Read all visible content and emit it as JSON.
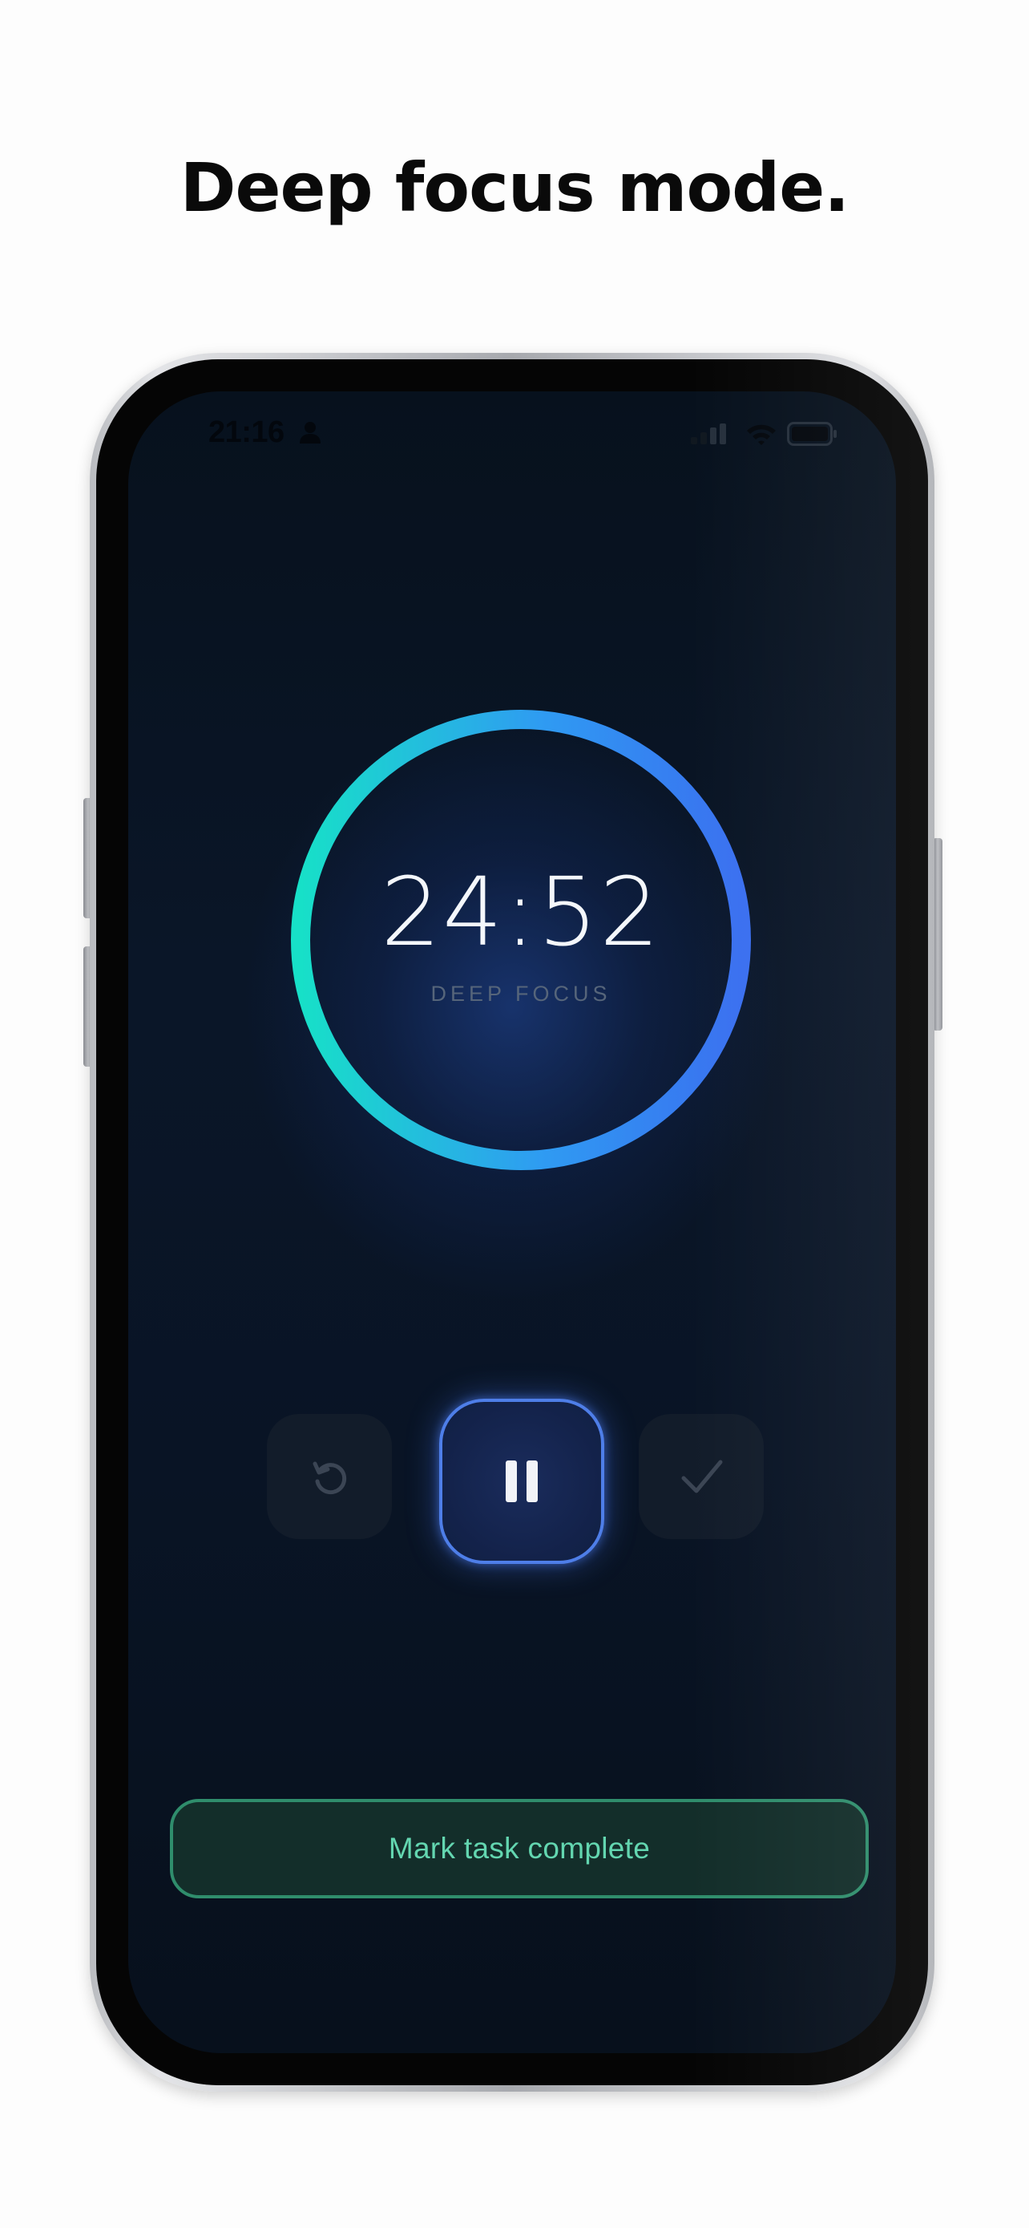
{
  "headline": "Deep focus mode.",
  "status_bar": {
    "time": "21:16",
    "icons": [
      "person-icon",
      "signal-icon",
      "wifi-icon",
      "battery-icon"
    ]
  },
  "timer": {
    "value": "24:52",
    "label": "DEEP FOCUS",
    "ring_gradient": [
      "#17e0c8",
      "#2f9bf2",
      "#3a6ff0"
    ]
  },
  "controls": {
    "reset_icon": "reset-icon",
    "pause_icon": "pause-icon",
    "done_icon": "checkmark-icon"
  },
  "complete_button": {
    "label": "Mark task complete",
    "color": "#63d6b0"
  }
}
